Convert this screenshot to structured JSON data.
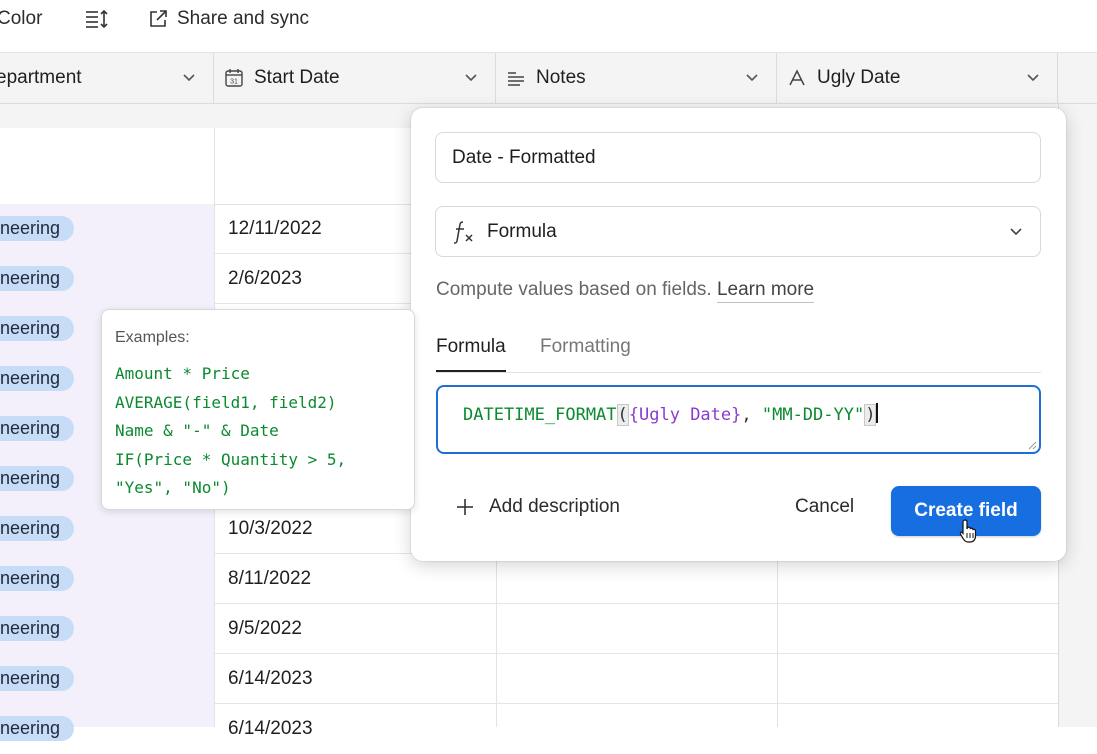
{
  "toolbar": {
    "color_label": "Color",
    "share_label": "Share and sync",
    "icons": [
      "row-height-icon",
      "share-external-icon"
    ]
  },
  "columns": [
    {
      "label": "epartment",
      "icon": "single-select-icon"
    },
    {
      "label": "Start Date",
      "icon": "calendar-icon"
    },
    {
      "label": "Notes",
      "icon": "long-text-icon"
    },
    {
      "label": "Ugly Date",
      "icon": "text-A-icon"
    }
  ],
  "rows": [
    {
      "dept": "neering",
      "date": "12/11/2022"
    },
    {
      "dept": "neering",
      "date": "2/6/2023"
    },
    {
      "dept": "neering",
      "date": ""
    },
    {
      "dept": "neering",
      "date": ""
    },
    {
      "dept": "neering",
      "date": ""
    },
    {
      "dept": "neering",
      "date": ""
    },
    {
      "dept": "neering",
      "date": "10/3/2022"
    },
    {
      "dept": "neering",
      "date": "8/11/2022"
    },
    {
      "dept": "neering",
      "date": "9/5/2022"
    },
    {
      "dept": "neering",
      "date": "6/14/2023"
    },
    {
      "dept": "neering",
      "date": "6/14/2023"
    }
  ],
  "examples": {
    "title": "Examples:",
    "lines": [
      "Amount * Price",
      "AVERAGE(field1, field2)",
      "Name & \"-\" & Date",
      "IF(Price * Quantity > 5,",
      "\"Yes\", \"No\")"
    ]
  },
  "popover": {
    "field_name": "Date - Formatted",
    "field_type": "Formula",
    "description": "Compute values based on fields.",
    "learn_more": "Learn more",
    "tabs": [
      "Formula",
      "Formatting"
    ],
    "formula": {
      "fn": "DATETIME_FORMAT",
      "open": "(",
      "ref": "{Ugly Date}",
      "sep": ", ",
      "str": "\"MM-DD-YY\"",
      "close": ")"
    },
    "add_description": "Add description",
    "cancel": "Cancel",
    "create": "Create field"
  },
  "colors": {
    "accent": "#166ee1",
    "pill": "#c7dcf6",
    "code_green": "#0b8a2f",
    "code_purple": "#8a3cc9"
  }
}
